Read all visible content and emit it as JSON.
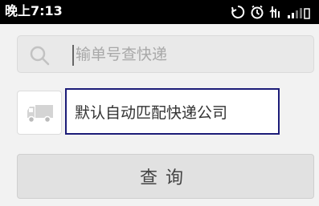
{
  "status_bar": {
    "time": "晚上7:13",
    "icons": [
      "sync-icon",
      "alarm-icon",
      "network-icon",
      "signal-icon"
    ]
  },
  "search": {
    "placeholder": "输单号查快递",
    "value": ""
  },
  "company": {
    "label": "默认自动匹配快递公司",
    "icon": "truck-icon"
  },
  "query_button": {
    "label": "查询"
  },
  "colors": {
    "status_bar_bg": "#000000",
    "field_border_highlight": "#1c1c78",
    "page_bg": "#f2f2f2"
  }
}
